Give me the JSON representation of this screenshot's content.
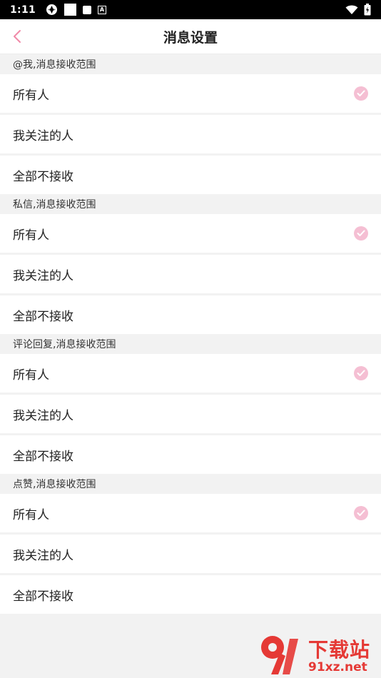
{
  "status_bar": {
    "time": "1:11",
    "badge_letter": "A"
  },
  "header": {
    "title": "消息设置"
  },
  "sections": [
    {
      "header": "@我,消息接收范围",
      "options": [
        {
          "label": "所有人",
          "selected": true
        },
        {
          "label": "我关注的人",
          "selected": false
        },
        {
          "label": "全部不接收",
          "selected": false
        }
      ]
    },
    {
      "header": "私信,消息接收范围",
      "options": [
        {
          "label": "所有人",
          "selected": true
        },
        {
          "label": "我关注的人",
          "selected": false
        },
        {
          "label": "全部不接收",
          "selected": false
        }
      ]
    },
    {
      "header": "评论回复,消息接收范围",
      "options": [
        {
          "label": "所有人",
          "selected": true
        },
        {
          "label": "我关注的人",
          "selected": false
        },
        {
          "label": "全部不接收",
          "selected": false
        }
      ]
    },
    {
      "header": "点赞,消息接收范围",
      "options": [
        {
          "label": "所有人",
          "selected": true
        },
        {
          "label": "我关注的人",
          "selected": false
        },
        {
          "label": "全部不接收",
          "selected": false
        }
      ]
    }
  ],
  "watermark": {
    "line1": "下载站",
    "line2": "91xz.net"
  },
  "colors": {
    "accent": "#f5bfd3",
    "back_arrow": "#f08aa8",
    "background": "#f2f2f2"
  }
}
